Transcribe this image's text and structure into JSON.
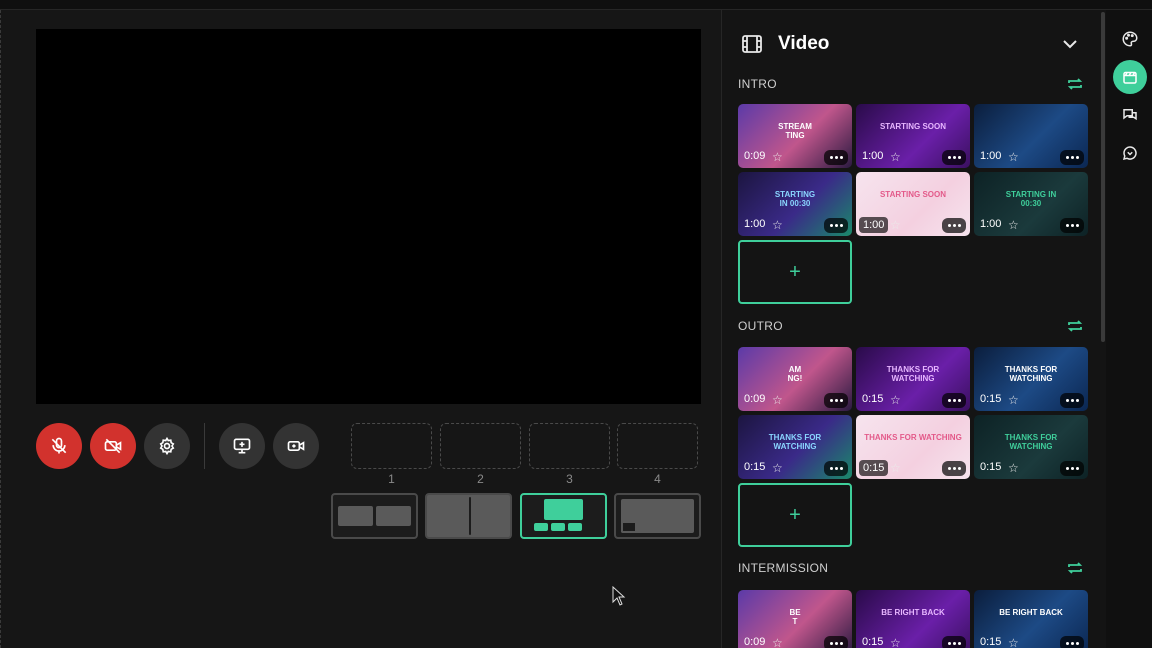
{
  "panel": {
    "title": "Video"
  },
  "controls": {
    "mic_icon": "mic-muted-icon",
    "cam_icon": "camera-off-icon",
    "settings_icon": "gear-icon",
    "share_icon": "screen-share-icon",
    "addcam_icon": "video-camera-icon"
  },
  "slots": [
    "1",
    "2",
    "3",
    "4"
  ],
  "sections": {
    "intro": {
      "label": "INTRO",
      "items": [
        {
          "text": "STREAM\nTING",
          "dur": "0:09"
        },
        {
          "text": "STARTING SOON",
          "dur": "1:00"
        },
        {
          "text": "",
          "dur": "1:00"
        },
        {
          "text": "STARTING\nIN 00:30",
          "dur": "1:00"
        },
        {
          "text": "STARTING SOON",
          "dur": "1:00"
        },
        {
          "text": "STARTING IN\n00:30",
          "dur": "1:00"
        }
      ]
    },
    "outro": {
      "label": "OUTRO",
      "items": [
        {
          "text": "AM\nNG!",
          "dur": "0:09"
        },
        {
          "text": "THANKS FOR\nWATCHING",
          "dur": "0:15"
        },
        {
          "text": "THANKS FOR\nWATCHING",
          "dur": "0:15"
        },
        {
          "text": "THANKS FOR\nWATCHING",
          "dur": "0:15"
        },
        {
          "text": "THANKS FOR WATCHING",
          "dur": "0:15"
        },
        {
          "text": "THANKS FOR\nWATCHING",
          "dur": "0:15"
        }
      ]
    },
    "intermission": {
      "label": "INTERMISSION",
      "items": [
        {
          "text": "BE\nT",
          "dur": "0:09"
        },
        {
          "text": "BE RIGHT BACK",
          "dur": "0:15"
        },
        {
          "text": "BE RIGHT BACK",
          "dur": "0:15"
        }
      ]
    }
  },
  "add_label": "+",
  "colors": {
    "accent": "#3fcf9b",
    "danger": "#d2322d"
  }
}
